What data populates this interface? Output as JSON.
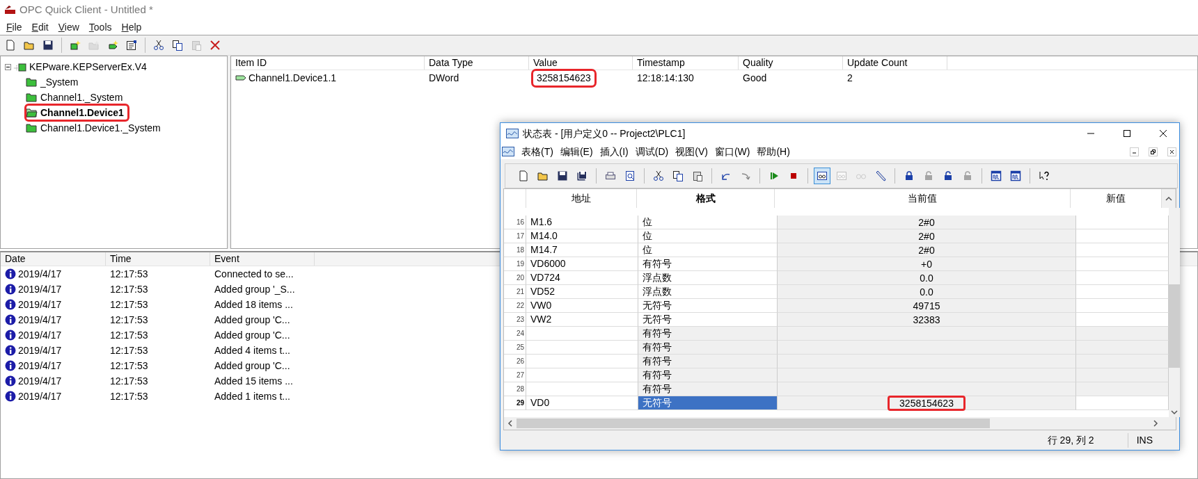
{
  "window": {
    "title": "OPC Quick Client - Untitled *"
  },
  "menu": [
    "File",
    "Edit",
    "View",
    "Tools",
    "Help"
  ],
  "toolbar": [
    {
      "kind": "new",
      "disabled": false
    },
    {
      "kind": "open",
      "disabled": false
    },
    {
      "kind": "save",
      "disabled": false
    },
    {
      "kind": "sep"
    },
    {
      "kind": "server",
      "disabled": false
    },
    {
      "kind": "group",
      "disabled": true
    },
    {
      "kind": "item",
      "disabled": false
    },
    {
      "kind": "properties",
      "disabled": false
    },
    {
      "kind": "sep"
    },
    {
      "kind": "cut",
      "disabled": false
    },
    {
      "kind": "copy",
      "disabled": false
    },
    {
      "kind": "paste",
      "disabled": true
    },
    {
      "kind": "delete",
      "disabled": false
    }
  ],
  "tree": {
    "label": "KEPware.KEPServerEx.V4",
    "expanded": true,
    "children": [
      {
        "label": "_System",
        "selected": false,
        "highlighted": false
      },
      {
        "label": "Channel1._System",
        "selected": false,
        "highlighted": false
      },
      {
        "label": "Channel1.Device1",
        "selected": true,
        "highlighted": true
      },
      {
        "label": "Channel1.Device1._System",
        "selected": false,
        "highlighted": false
      }
    ]
  },
  "items": {
    "columns": [
      "Item ID",
      "Data Type",
      "Value",
      "Timestamp",
      "Quality",
      "Update Count"
    ],
    "rows": [
      {
        "item_id": "Channel1.Device1.1",
        "data_type": "DWord",
        "value": "3258154623",
        "timestamp": "12:18:14:130",
        "quality": "Good",
        "update_count": "2",
        "value_highlighted": true
      }
    ]
  },
  "log": {
    "columns": [
      "Date",
      "Time",
      "Event"
    ],
    "rows": [
      {
        "date": "2019/4/17",
        "time": "12:17:53",
        "event": "Connected to se..."
      },
      {
        "date": "2019/4/17",
        "time": "12:17:53",
        "event": "Added group '_S..."
      },
      {
        "date": "2019/4/17",
        "time": "12:17:53",
        "event": "Added 18 items ..."
      },
      {
        "date": "2019/4/17",
        "time": "12:17:53",
        "event": "Added group 'C..."
      },
      {
        "date": "2019/4/17",
        "time": "12:17:53",
        "event": "Added group 'C..."
      },
      {
        "date": "2019/4/17",
        "time": "12:17:53",
        "event": "Added 4 items t..."
      },
      {
        "date": "2019/4/17",
        "time": "12:17:53",
        "event": "Added group 'C..."
      },
      {
        "date": "2019/4/17",
        "time": "12:17:53",
        "event": "Added 15 items ..."
      },
      {
        "date": "2019/4/17",
        "time": "12:17:53",
        "event": "Added 1 items t..."
      }
    ]
  },
  "status_window": {
    "title": "状态表 - [用户定义0 -- Project2\\PLC1]",
    "menu": [
      "表格(T)",
      "编辑(E)",
      "插入(I)",
      "调试(D)",
      "视图(V)",
      "窗口(W)",
      "帮助(H)"
    ],
    "toolbar": [
      {
        "kind": "new",
        "disabled": false,
        "pressed": false
      },
      {
        "kind": "open",
        "disabled": false,
        "pressed": false
      },
      {
        "kind": "save",
        "disabled": false,
        "pressed": false
      },
      {
        "kind": "saveall",
        "disabled": false,
        "pressed": false
      },
      {
        "kind": "sep"
      },
      {
        "kind": "print",
        "disabled": false,
        "pressed": false
      },
      {
        "kind": "preview",
        "disabled": false,
        "pressed": false
      },
      {
        "kind": "sep"
      },
      {
        "kind": "cut",
        "disabled": false,
        "pressed": false
      },
      {
        "kind": "copy",
        "disabled": false,
        "pressed": false
      },
      {
        "kind": "paste",
        "disabled": false,
        "pressed": false
      },
      {
        "kind": "sep"
      },
      {
        "kind": "undo",
        "disabled": false,
        "pressed": false
      },
      {
        "kind": "redo",
        "disabled": false,
        "pressed": false
      },
      {
        "kind": "sep"
      },
      {
        "kind": "run",
        "disabled": false,
        "pressed": false
      },
      {
        "kind": "stop",
        "disabled": false,
        "pressed": false
      },
      {
        "kind": "sep"
      },
      {
        "kind": "glasses-window",
        "disabled": false,
        "pressed": true
      },
      {
        "kind": "glasses-window",
        "disabled": true,
        "pressed": false
      },
      {
        "kind": "glasses",
        "disabled": true,
        "pressed": false
      },
      {
        "kind": "pencil",
        "disabled": false,
        "pressed": false
      },
      {
        "kind": "sep"
      },
      {
        "kind": "lock",
        "disabled": false,
        "pressed": false
      },
      {
        "kind": "unlock",
        "disabled": true,
        "pressed": false
      },
      {
        "kind": "unlock",
        "disabled": false,
        "pressed": false
      },
      {
        "kind": "unlock",
        "disabled": true,
        "pressed": false
      },
      {
        "kind": "sep"
      },
      {
        "kind": "chart-window",
        "disabled": false,
        "pressed": false
      },
      {
        "kind": "chart-window",
        "disabled": false,
        "pressed": false
      },
      {
        "kind": "sep"
      },
      {
        "kind": "help",
        "disabled": false,
        "pressed": false
      }
    ],
    "columns": [
      "地址",
      "格式",
      "当前值",
      "新值"
    ],
    "rows": [
      {
        "number": "16",
        "address": "M1.6",
        "format": "位",
        "current": "2#0",
        "selected": false,
        "highlighted": false
      },
      {
        "number": "17",
        "address": "M14.0",
        "format": "位",
        "current": "2#0",
        "selected": false,
        "highlighted": false
      },
      {
        "number": "18",
        "address": "M14.7",
        "format": "位",
        "current": "2#0",
        "selected": false,
        "highlighted": false
      },
      {
        "number": "19",
        "address": "VD6000",
        "format": "有符号",
        "current": "+0",
        "selected": false,
        "highlighted": false
      },
      {
        "number": "20",
        "address": "VD724",
        "format": "浮点数",
        "current": "0.0",
        "selected": false,
        "highlighted": false
      },
      {
        "number": "21",
        "address": "VD52",
        "format": "浮点数",
        "current": "0.0",
        "selected": false,
        "highlighted": false
      },
      {
        "number": "22",
        "address": "VW0",
        "format": "无符号",
        "current": "49715",
        "selected": false,
        "highlighted": false
      },
      {
        "number": "23",
        "address": "VW2",
        "format": "无符号",
        "current": "32383",
        "selected": false,
        "highlighted": false
      },
      {
        "number": "24",
        "format": "有符号",
        "selected": false,
        "highlighted": false
      },
      {
        "number": "25",
        "format": "有符号",
        "selected": false,
        "highlighted": false
      },
      {
        "number": "26",
        "format": "有符号",
        "selected": false,
        "highlighted": false
      },
      {
        "number": "27",
        "format": "有符号",
        "selected": false,
        "highlighted": false
      },
      {
        "number": "28",
        "format": "有符号",
        "selected": false,
        "highlighted": false
      },
      {
        "number": "29",
        "address": "VD0",
        "format": "无符号",
        "current": "3258154623",
        "selected": true,
        "highlighted": true
      }
    ],
    "status_bar": [
      "行 29, 列 2",
      "INS"
    ]
  }
}
